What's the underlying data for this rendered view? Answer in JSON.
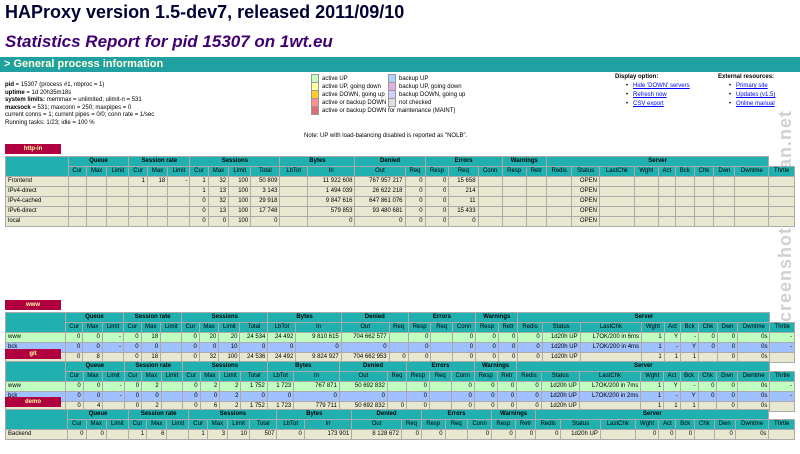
{
  "title": "HAProxy version 1.5-dev7, released 2011/09/10",
  "subtitle": "Statistics Report for pid 15307 on 1wt.eu",
  "section": "> General process information",
  "procinfo": [
    [
      "pid",
      " = 15307 (process #1, nbproc = 1)"
    ],
    [
      "uptime",
      " = 1d 20h35m18s"
    ],
    [
      "system limits:",
      " memmax = unlimited; ulimit-n = 531"
    ],
    [
      "maxsock",
      " = 531; maxconn = 250; maxpipes = 0"
    ],
    [
      "",
      "current conns = 1; current pipes = 0/0; conn rate = 1/sec"
    ],
    [
      "",
      "Running tasks: 1/23; idle = 100 %"
    ]
  ],
  "legend": {
    "col1": [
      {
        "color": "#c0ffc0",
        "label": "active UP"
      },
      {
        "color": "#ffffa0",
        "label": "active UP, going down"
      },
      {
        "color": "#ffd020",
        "label": "active DOWN, going up"
      },
      {
        "color": "#ff9090",
        "label": "active or backup DOWN"
      },
      {
        "color": "#e07070",
        "label": "active or backup DOWN for maintenance (MAINT)"
      }
    ],
    "col2": [
      {
        "color": "#b0d0ff",
        "label": "backup UP"
      },
      {
        "color": "#e0b0e0",
        "label": "backup UP, going down"
      },
      {
        "color": "#d0d0ff",
        "label": "backup DOWN, going up"
      },
      {
        "color": "#e0e0e0",
        "label": "not checked"
      }
    ],
    "note": "Note: UP with load-balancing disabled is reported as \"NOLB\"."
  },
  "display_option": {
    "title": "Display option:",
    "items": [
      "Hide 'DOWN' servers",
      "Refresh now",
      "CSV export"
    ]
  },
  "external": {
    "title": "External resources:",
    "items": [
      "Primary site",
      "Updates (v1.5)",
      "Online manual"
    ]
  },
  "watermark": "screenshots.debian.net",
  "headers": {
    "groups": [
      "Queue",
      "Session rate",
      "Sessions",
      "Bytes",
      "Denied",
      "Errors",
      "Warnings",
      "Server"
    ],
    "sub_fe": [
      "Cur",
      "Max",
      "Limit",
      "Cur",
      "Max",
      "Limit",
      "Cur",
      "Max",
      "Limit",
      "Total",
      "LbTot",
      "In",
      "Out",
      "Req",
      "Resp",
      "Req",
      "Conn",
      "Resp",
      "Retr",
      "Redis",
      "Status",
      "LastChk",
      "Wght",
      "Act",
      "Bck",
      "Chk",
      "Dwn",
      "Dwntme",
      "Thrtle"
    ]
  },
  "proxies": [
    {
      "name": "http-in",
      "rows": [
        {
          "cls": "fe",
          "cells": [
            "Frontend",
            "",
            "",
            "",
            "1",
            "18",
            "-",
            "1",
            "32",
            "100",
            "50 809",
            "",
            "11 922 608",
            "767 957 217",
            "0",
            "0",
            "15 658",
            "",
            "",
            "",
            "",
            "OPEN",
            "",
            "",
            "",
            "",
            "",
            "",
            "",
            ""
          ]
        },
        {
          "cls": "fe",
          "cells": [
            "IPv4-direct",
            "",
            "",
            "",
            "",
            "",
            "",
            "1",
            "13",
            "100",
            "3 143",
            "",
            "1 494 039",
            "26 622 218",
            "0",
            "0",
            "214",
            "",
            "",
            "",
            "",
            "OPEN",
            "",
            "",
            "",
            "",
            "",
            "",
            "",
            ""
          ]
        },
        {
          "cls": "fe",
          "cells": [
            "IPv4-cached",
            "",
            "",
            "",
            "",
            "",
            "",
            "0",
            "32",
            "100",
            "29 918",
            "",
            "9 847 616",
            "647 861 076",
            "0",
            "0",
            "11",
            "",
            "",
            "",
            "",
            "OPEN",
            "",
            "",
            "",
            "",
            "",
            "",
            "",
            ""
          ]
        },
        {
          "cls": "fe",
          "cells": [
            "IPv6-direct",
            "",
            "",
            "",
            "",
            "",
            "",
            "0",
            "13",
            "100",
            "17 748",
            "",
            "579 853",
            "93 480 681",
            "0",
            "0",
            "15 433",
            "",
            "",
            "",
            "",
            "OPEN",
            "",
            "",
            "",
            "",
            "",
            "",
            "",
            ""
          ]
        },
        {
          "cls": "fe",
          "cells": [
            "local",
            "",
            "",
            "",
            "",
            "",
            "",
            "0",
            "0",
            "100",
            "0",
            "",
            "0",
            "0",
            "0",
            "0",
            "0",
            "",
            "",
            "",
            "",
            "OPEN",
            "",
            "",
            "",
            "",
            "",
            "",
            "",
            ""
          ]
        }
      ]
    },
    {
      "name": "www",
      "rows": [
        {
          "cls": "up",
          "cells": [
            "www",
            "0",
            "0",
            "-",
            "0",
            "18",
            "",
            "0",
            "20",
            "20",
            "24 534",
            "24 492",
            "9 810 615",
            "704 662 577",
            "",
            "0",
            "",
            "0",
            "0",
            "0",
            "0",
            "1d20h UP",
            "L7OK/200 in 6ms",
            "1",
            "Y",
            "-",
            "0",
            "0",
            "0s",
            "-"
          ]
        },
        {
          "cls": "dn",
          "cells": [
            "bck",
            "0",
            "0",
            "-",
            "0",
            "0",
            "",
            "0",
            "0",
            "10",
            "0",
            "0",
            "0",
            "0",
            "",
            "0",
            "",
            "0",
            "0",
            "0",
            "0",
            "1d20h UP",
            "L7OK/200 in 4ms",
            "1",
            "-",
            "Y",
            "0",
            "0",
            "0s",
            "-"
          ]
        },
        {
          "cls": "be",
          "cells": [
            "Backend",
            "0",
            "8",
            "",
            "0",
            "18",
            "",
            "0",
            "32",
            "100",
            "24 536",
            "24 492",
            "9 824 927",
            "704 662 953",
            "0",
            "0",
            "",
            "0",
            "0",
            "0",
            "0",
            "1d20h UP",
            "",
            "1",
            "1",
            "1",
            "",
            "0",
            "0s",
            ""
          ]
        }
      ]
    },
    {
      "name": "git",
      "rows": [
        {
          "cls": "up",
          "cells": [
            "www",
            "0",
            "0",
            "-",
            "0",
            "2",
            "",
            "0",
            "2",
            "2",
            "1 752",
            "1 723",
            "767 871",
            "50 692 832",
            "",
            "0",
            "",
            "0",
            "0",
            "0",
            "0",
            "1d20h UP",
            "L7OK/200 in 7ms",
            "1",
            "Y",
            "-",
            "0",
            "0",
            "0s",
            "-"
          ]
        },
        {
          "cls": "dn",
          "cells": [
            "bck",
            "0",
            "0",
            "-",
            "0",
            "0",
            "",
            "0",
            "0",
            "2",
            "0",
            "0",
            "0",
            "0",
            "",
            "0",
            "",
            "0",
            "0",
            "0",
            "0",
            "1d20h UP",
            "L7OK/200 in 2ms",
            "1",
            "-",
            "Y",
            "0",
            "0",
            "0s",
            "-"
          ]
        },
        {
          "cls": "be",
          "cells": [
            "Backend",
            "0",
            "4",
            "",
            "0",
            "2",
            "",
            "0",
            "6",
            "2",
            "1 752",
            "1 723",
            "779 711",
            "50 692 832",
            "0",
            "0",
            "",
            "0",
            "0",
            "0",
            "0",
            "1d20h UP",
            "",
            "1",
            "1",
            "1",
            "",
            "0",
            "0s",
            ""
          ]
        }
      ]
    },
    {
      "name": "demo",
      "rows": [
        {
          "cls": "be",
          "cells": [
            "Backend",
            "0",
            "0",
            "",
            "1",
            "6",
            "",
            "1",
            "3",
            "10",
            "507",
            "0",
            "173 901",
            "8 128 672",
            "0",
            "0",
            "",
            "0",
            "0",
            "0",
            "0",
            "1d20h UP",
            "",
            "0",
            "0",
            "0",
            "",
            "0",
            "0s",
            ""
          ]
        }
      ]
    }
  ]
}
